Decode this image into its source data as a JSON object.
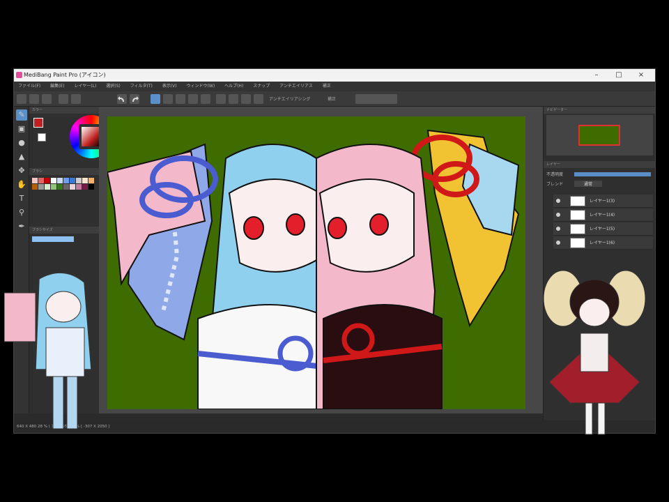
{
  "window": {
    "title": "MediBang Paint Pro (アイコン)"
  },
  "menu": [
    "ファイル(F)",
    "編集(E)",
    "レイヤー(L)",
    "選択(S)",
    "フィルタ(T)",
    "表示(V)",
    "ウィンドウ(W)",
    "ヘルプ(H)",
    "スナップ",
    "アンチエイリアス",
    "補正"
  ],
  "toolbar": {
    "snap_label": "アンチエイリアシング",
    "correction_label": "補正",
    "scale_label": ""
  },
  "panels": {
    "color": "カラー",
    "palette": "ブラシ",
    "brush_size": "ブラシサイズ",
    "navigator": "ナビゲーター",
    "layer": "レイヤー",
    "opacity_label": "不透明度",
    "blend_label": "ブレンド",
    "blend_value": "通常"
  },
  "layers": [
    "レイヤー1(3)",
    "レイヤー1(4)",
    "レイヤー1(5)",
    "レイヤー1(6)"
  ],
  "status": "640 X 480    28 %  ( 150,255 )    24%   [ -307 X 2050 ]",
  "colors": {
    "canvas_bg": "#3e6c00",
    "accent": "#5b8fc9",
    "app_bg": "#2b2b2b"
  },
  "icons": [
    "pen-icon",
    "eraser-icon",
    "select-icon",
    "move-icon",
    "fill-icon",
    "undo-icon",
    "redo-icon",
    "eye-icon"
  ]
}
